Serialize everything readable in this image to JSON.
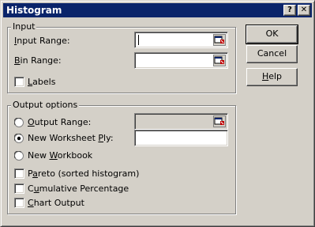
{
  "window": {
    "title": "Histogram",
    "help_glyph": "?",
    "close_glyph": "✕"
  },
  "input_group": {
    "legend": "Input",
    "input_range": {
      "accel": "I",
      "rest": "nput Range:",
      "value": ""
    },
    "bin_range": {
      "accel": "B",
      "rest": "in Range:",
      "value": ""
    },
    "labels": {
      "accel": "L",
      "rest": "abels",
      "checked": false
    }
  },
  "output_group": {
    "legend": "Output options",
    "output_range": {
      "accel": "O",
      "rest": "utput Range:",
      "selected": false,
      "value": ""
    },
    "new_worksheet": {
      "pre": "New Worksheet ",
      "accel": "P",
      "rest": "ly:",
      "selected": true,
      "value": ""
    },
    "new_workbook": {
      "pre": "New ",
      "accel": "W",
      "rest": "orkbook",
      "selected": false
    },
    "pareto": {
      "pre": "P",
      "accel": "a",
      "rest": "reto (sorted histogram)",
      "checked": false
    },
    "cumulative": {
      "pre": "C",
      "accel": "u",
      "rest": "mulative Percentage",
      "checked": false
    },
    "chart_output": {
      "accel": "C",
      "rest": "hart Output",
      "checked": false
    }
  },
  "buttons": {
    "ok": "OK",
    "cancel": "Cancel",
    "help": {
      "accel": "H",
      "rest": "elp"
    }
  },
  "colors": {
    "titlebar": "#0a246a",
    "face": "#d4d0c8",
    "field": "#ffffff"
  }
}
